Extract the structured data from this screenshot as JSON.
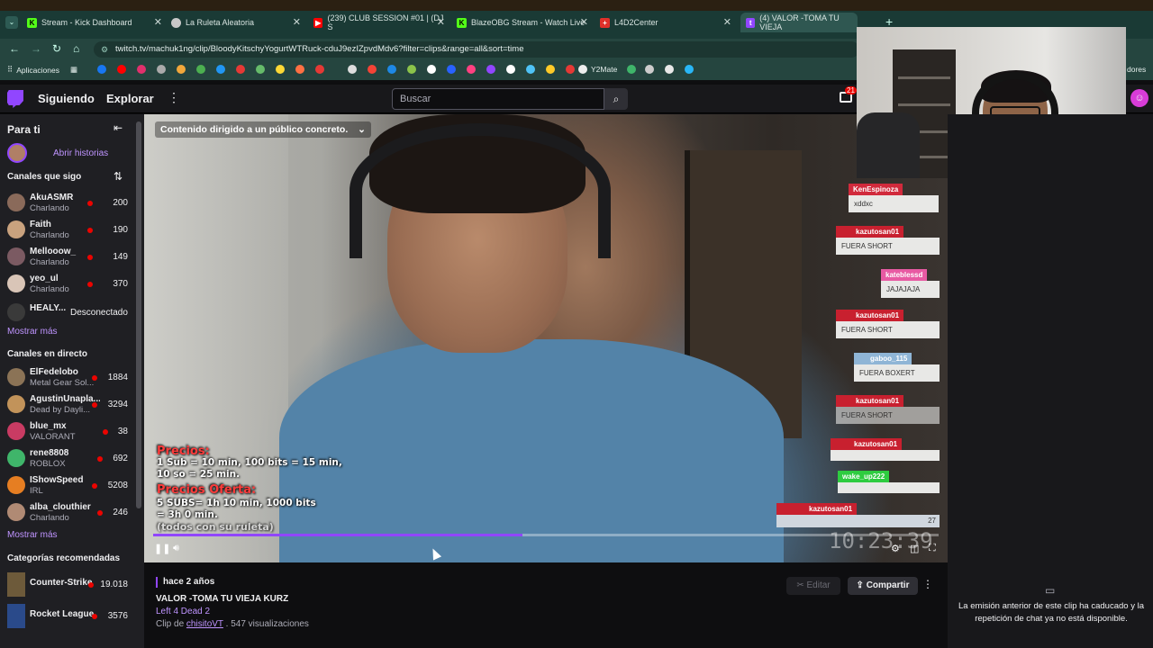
{
  "browser": {
    "tabs": [
      {
        "label": "Stream - Kick Dashboard",
        "icon": "kick-icon",
        "color": "#53fc18"
      },
      {
        "label": "La Ruleta Aleatoria",
        "icon": "globe-icon",
        "color": "#c8c8c8"
      },
      {
        "label": "(239) CLUB SESSION #01 | (DJ S",
        "icon": "youtube-icon",
        "color": "#ff0000"
      },
      {
        "label": "BlazeOBG Stream - Watch Live",
        "icon": "kick-icon",
        "color": "#53fc18"
      },
      {
        "label": "L4D2Center",
        "icon": "plus-icon",
        "color": "#e0302a"
      },
      {
        "label": "(4) VALOR -TOMA TU VIEJA",
        "icon": "twitch-icon",
        "color": "#9146ff"
      }
    ],
    "url": "twitch.tv/machuk1ng/clip/BloodyKitschyYogurtWTRuck-cduJ9ezIZpvdMdv6?filter=clips&range=all&sort=time",
    "bookmarks_label": "Aplicaciones",
    "bookmark_y2mate": "Y2Mate",
    "bookmark_right": "dores"
  },
  "topnav": {
    "following": "Siguiendo",
    "browse": "Explorar",
    "search_placeholder": "Buscar",
    "notif_count": "21"
  },
  "sidebar": {
    "for_you": "Para ti",
    "stories": "Abrir historias",
    "followed_title": "Canales que sigo",
    "followed": [
      {
        "name": "AkuASMR",
        "game": "Charlando",
        "viewers": "200",
        "color": "#8a6a5a"
      },
      {
        "name": "Faith",
        "game": "Charlando",
        "viewers": "190",
        "color": "#c9a27e"
      },
      {
        "name": "Mellooow_",
        "game": "Charlando",
        "viewers": "149",
        "color": "#7b5a62"
      },
      {
        "name": "yeo_ul",
        "game": "Charlando",
        "viewers": "370",
        "color": "#d9c5b7"
      },
      {
        "name": "HEALY...",
        "game": "",
        "viewers": "",
        "status": "Desconectado",
        "color": "#3a3a3a"
      }
    ],
    "show_more": "Mostrar más",
    "live_title": "Canales en directo",
    "live": [
      {
        "name": "ElFedelobo",
        "game": "Metal Gear Sol...",
        "viewers": "1884",
        "color": "#8b7356"
      },
      {
        "name": "AgustinUnapla...",
        "game": "Dead by Dayli...",
        "viewers": "3294",
        "color": "#c2935a"
      },
      {
        "name": "blue_mx",
        "game": "VALORANT",
        "viewers": "38",
        "color": "#c93b63"
      },
      {
        "name": "rene8808",
        "game": "ROBLOX",
        "viewers": "692",
        "color": "#3fb56a"
      },
      {
        "name": "IShowSpeed",
        "game": "IRL",
        "viewers": "5208",
        "color": "#e67e22"
      },
      {
        "name": "alba_clouthier",
        "game": "Charlando",
        "viewers": "246",
        "color": "#b08a74"
      }
    ],
    "show_more2": "Mostrar más",
    "cats_title": "Categorías recomendadas",
    "categories": [
      {
        "name": "Counter-Strike",
        "viewers": "19.018",
        "color": "#6d5a3a"
      },
      {
        "name": "Rocket League",
        "viewers": "3576",
        "color": "#2a4a8a"
      }
    ]
  },
  "video": {
    "age_banner": "Contenido dirigido a un público concreto.",
    "prices_title": "Precios:",
    "prices_line1": "1 Sub = 10 min, 100 bits = 15 min,",
    "prices_line2": "10 so = 25 min.",
    "offer_title": "Precios Oferta:",
    "offer_line1": "5 SUBS= 1h 10 min, 1000 bits",
    "offer_line2": "= 3h 0 min.",
    "offer_line3": "(todos con su ruleta)",
    "timer": "10:23:39",
    "progress_fraction": 0.47,
    "overlay_chat": [
      {
        "user": "KenEspinoza",
        "msg": "xddxc",
        "color": "#d12a3c"
      },
      {
        "user": "kazutosan01",
        "msg": "FUERA SHORT",
        "color": "#c8202f"
      },
      {
        "user": "kateblessd",
        "msg": "JAJAJAJA",
        "color": "#e85aa3"
      },
      {
        "user": "kazutosan01",
        "msg": "FUERA SHORT",
        "color": "#c8202f"
      },
      {
        "user": "gaboo_115",
        "msg": "FUERA BOXERT",
        "color": "#8fb5d6"
      },
      {
        "user": "kazutosan01",
        "msg": "FUERA SHORT",
        "color": "#c8202f"
      },
      {
        "user": "kazutosan01",
        "msg": "",
        "color": "#c8202f"
      },
      {
        "user": "wake_up222",
        "msg": "",
        "color": "#2ecc40"
      },
      {
        "user": "kazutosan01",
        "msg": "",
        "color": "#c8202f"
      }
    ],
    "overlay_count": "27"
  },
  "clip": {
    "ago": "hace 2 años",
    "title": "VALOR -TOMA TU VIEJA KURZ",
    "game": "Left 4 Dead 2",
    "clip_by_prefix": "Clip de",
    "clipper": "chisitoVT",
    "views": ". 547 visualizaciones",
    "edit": "Editar",
    "share": "Compartir"
  },
  "chat": {
    "message": "La emisión anterior de este clip ha caducado y la repetición de chat ya no está disponible."
  },
  "colors": {
    "accent": "#9146ff",
    "live": "#eb0400"
  }
}
